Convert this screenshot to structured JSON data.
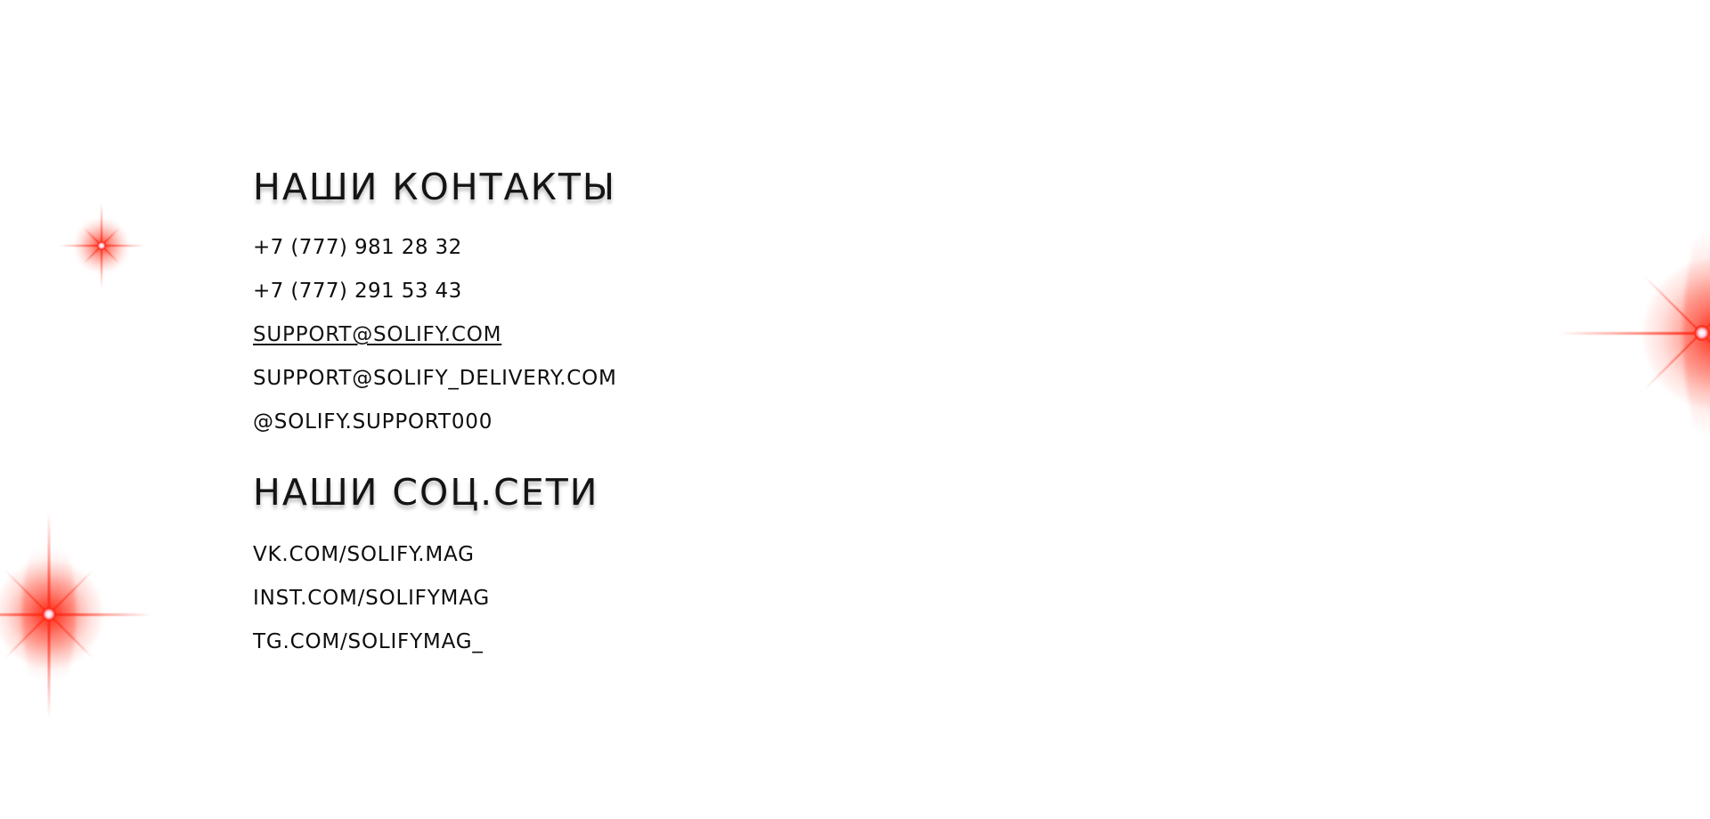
{
  "contacts": {
    "title": "НАШИ КОНТАКТЫ",
    "phone_1": "+7 (777) 981 28 32",
    "phone_2": "+7 (777) 291 53 43",
    "email_1": "SUPPORT@SOLIFY.COM",
    "email_2": "SUPPORT@SOLIFY_DELIVERY.COM",
    "handle": "@SOLIFY.SUPPORT000"
  },
  "socials": {
    "title": "НАШИ СОЦ.СЕТИ",
    "vk": "VK.COM/SOLIFY.MAG",
    "inst": "INST.COM/SOLIFYMAG",
    "tg": "TG.COM/SOLIFYMAG_"
  },
  "decor": {
    "sparkle_icon": "red-sparkle-icon",
    "accent_color": "#ff2a14"
  }
}
